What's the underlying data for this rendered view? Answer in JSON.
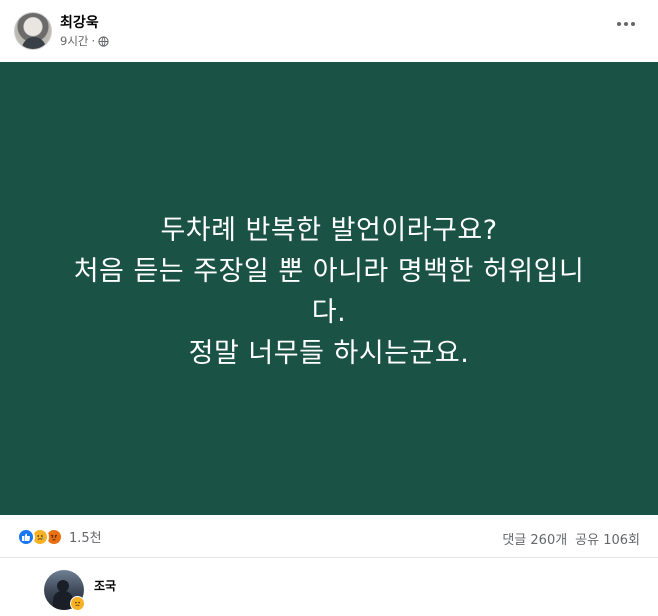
{
  "post": {
    "author": "최강욱",
    "time": "9시간",
    "privacy_icon": "globe-icon",
    "more_icon": "more-options-icon",
    "image_text": [
      "두차례 반복한 발언이라구요?",
      "처음 듣는 주장일 뿐 아니라 명백한 허위입니",
      "다.",
      "정말 너무들 하시는군요."
    ],
    "image_bg_color": "#1a5346",
    "reaction_icons": [
      "like-icon",
      "sad-icon",
      "angry-icon"
    ],
    "reaction_count": "1.5천",
    "comments": "댓글 260개",
    "shares": "공유 106회"
  },
  "comment": {
    "author": "조국",
    "emoji_icon": "sad-icon"
  }
}
